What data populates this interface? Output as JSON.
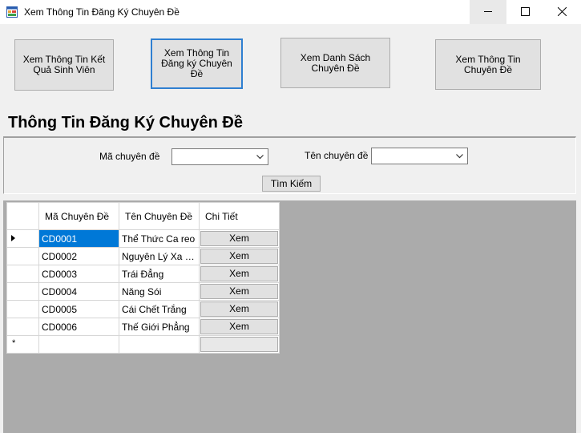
{
  "window": {
    "title": "Xem Thông Tin Đăng Ký Chuyên Đề"
  },
  "nav_buttons": [
    {
      "label": "Xem Thông Tin Kết Quả Sinh Viên"
    },
    {
      "label": "Xem Thông Tin Đăng ký Chuyên Đề"
    },
    {
      "label": "Xem Danh Sách Chuyên Đề"
    },
    {
      "label": "Xem Thông Tin Chuyên Đề"
    }
  ],
  "heading": "Thông Tin Đăng Ký Chuyên Đề",
  "filters": {
    "ma_label": "Mã chuyên đề",
    "ma_value": "",
    "ten_label": "Tên chuyên đề",
    "ten_value": "",
    "search_label": "Tìm Kiếm"
  },
  "grid": {
    "columns": [
      "Mã Chuyên Đề",
      "Tên Chuyên Đề",
      "Chi Tiết"
    ],
    "rows": [
      {
        "ma": "CD0001",
        "ten": "Thể Thức Ca reo",
        "action": "Xem"
      },
      {
        "ma": "CD0002",
        "ten": "Nguyên  Lý Xa Gần",
        "action": "Xem"
      },
      {
        "ma": "CD0003",
        "ten": "Trái Đẳng",
        "action": "Xem"
      },
      {
        "ma": "CD0004",
        "ten": "Năng Sói",
        "action": "Xem"
      },
      {
        "ma": "CD0005",
        "ten": "Cái Chết Trắng",
        "action": "Xem"
      },
      {
        "ma": "CD0006",
        "ten": "Thế Giới Phẳng",
        "action": "Xem"
      }
    ],
    "new_row_marker": "*"
  }
}
